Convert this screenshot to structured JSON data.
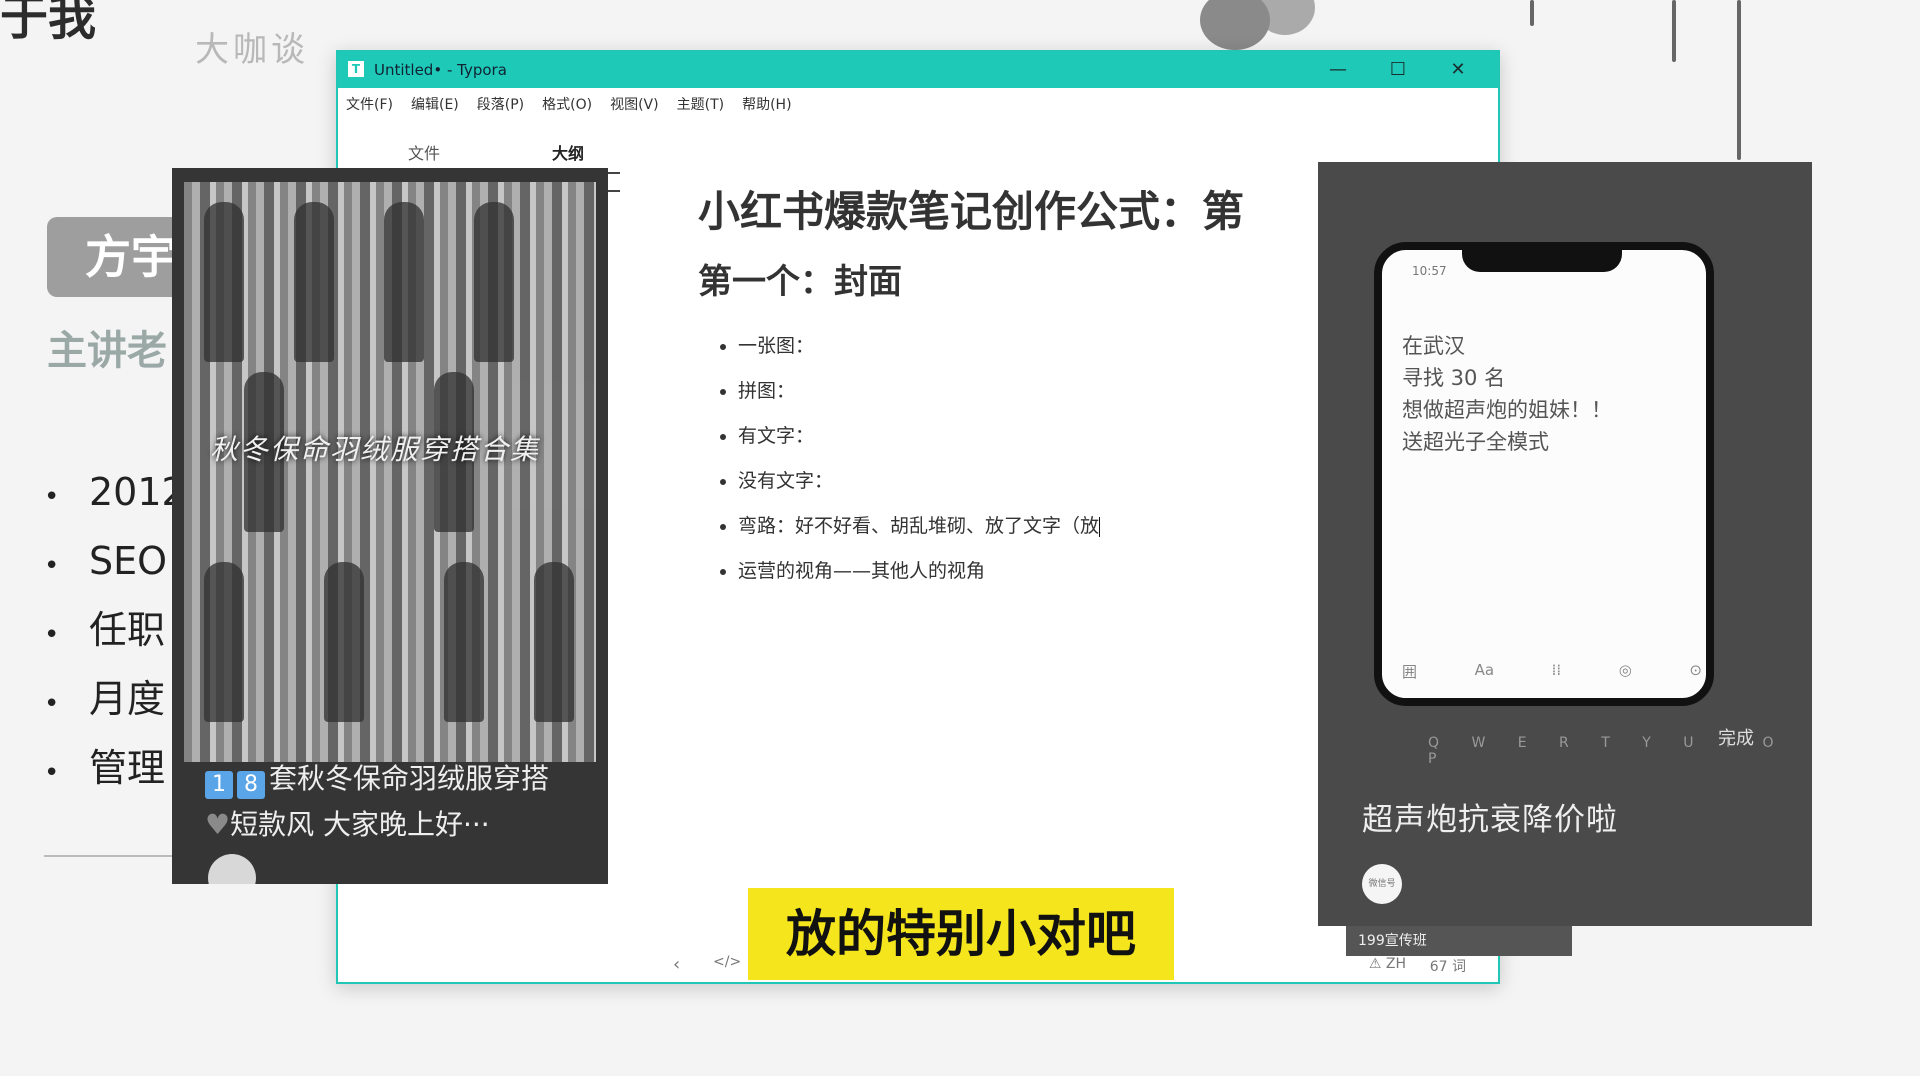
{
  "background_slide": {
    "title": "于我",
    "logo": "大咖谈",
    "tag": "方宇",
    "subtitle": "主讲老",
    "bullets": [
      "2012",
      "SEO",
      "任职",
      "月度",
      "管理"
    ]
  },
  "window": {
    "title": "Untitled• - Typora",
    "menu": [
      "文件(F)",
      "编辑(E)",
      "段落(P)",
      "格式(O)",
      "视图(V)",
      "主题(T)",
      "帮助(H)"
    ],
    "sidebar_tabs": {
      "files": "文件",
      "outline": "大纲"
    },
    "doc": {
      "h1": "小红书爆款笔记创作公式：第",
      "h2": "第一个：封面",
      "items": [
        "一张图：",
        "拼图：",
        "有文字：",
        "没有文字：",
        "弯路：好不好看、胡乱堆砌、放了文字（放",
        "运营的视角——其他人的视角"
      ]
    },
    "status": {
      "lang": "ZH",
      "words": "67 词"
    }
  },
  "left_card": {
    "photo_text": "秋冬保命羽绒服穿搭合集",
    "badges": [
      "1",
      "8"
    ],
    "caption": "套秋冬保命羽绒服穿搭",
    "caption2": "短款风 大家晚上好···"
  },
  "right_card": {
    "phone_time": "10:57",
    "phone_lines": [
      "在武汉",
      "寻找 30 名",
      "想做超声炮的姐妹！！",
      "送超光子全模式"
    ],
    "phone_tools": [
      "囲",
      "Aa",
      "⁞⁞",
      "◎",
      "⊙"
    ],
    "keyboard_row": "Q W E R T Y U I O P",
    "done_label": "完成",
    "title": "超声炮抗衰降价啦",
    "avatar_text": "微信号",
    "below_text": "199宣传班"
  },
  "subtitle": "放的特别小对吧"
}
